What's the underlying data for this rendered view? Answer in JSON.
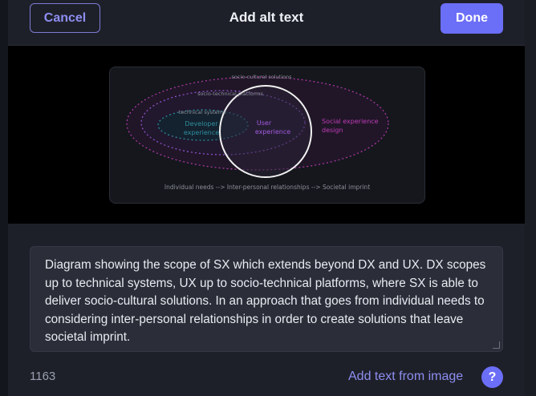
{
  "header": {
    "cancel_label": "Cancel",
    "title": "Add alt text",
    "done_label": "Done"
  },
  "diagram": {
    "outer_label": "socio-cultural solutions",
    "middle_label": "socio-technical platforms",
    "inner_label": "technical systems",
    "developer_label_1": "Developer",
    "developer_label_2": "experience",
    "user_label_1": "User",
    "user_label_2": "experience",
    "social_label_1": "Social experience",
    "social_label_2": "design",
    "bottom_caption": "Individual needs --> Inter-personal relationships --> Societal imprint"
  },
  "alt_text": {
    "value": "Diagram showing the scope of SX which extends beyond DX and UX. DX scopes up to technical systems, UX up to socio-technical platforms, where SX is able to deliver socio-cultural solutions. In an approach that goes from individual needs to considering inter-personal relationships in order to create solutions that leave societal imprint."
  },
  "footer": {
    "char_count": "1163",
    "add_text_label": "Add text from image",
    "help_label": "?"
  },
  "colors": {
    "accent": "#6b6ef7",
    "modal_bg": "#1e2029",
    "magenta": "#c03bb8",
    "teal": "#2f8fa0",
    "purple": "#a55ae0"
  }
}
